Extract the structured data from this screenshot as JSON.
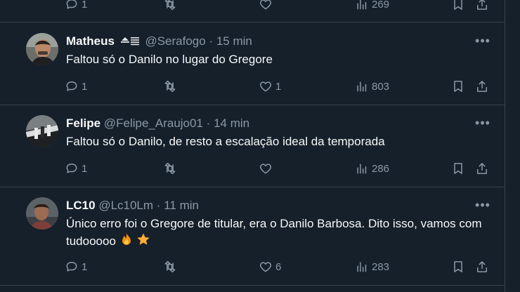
{
  "top_partial": {
    "replies": "1",
    "views": "269"
  },
  "tweets": [
    {
      "name": "Matheus",
      "handle": "@Serafogo",
      "dot": "·",
      "time": "15 min",
      "text": "Faltou só o Danilo no lugar do Gregore",
      "replies": "1",
      "likes": "1",
      "views": "803",
      "avatar": "avatar-photo"
    },
    {
      "name": "Felipe",
      "handle": "@Felipe_Araujo01",
      "dot": "·",
      "time": "14 min",
      "text": "Faltou só o Danilo, de resto a escalação ideal da temporada",
      "replies": "1",
      "likes": "",
      "views": "286",
      "avatar": "avatar-photo"
    },
    {
      "name": "LC10",
      "handle": "@Lc10Lm",
      "dot": "·",
      "time": "11 min",
      "text": "Único erro foi o Gregore de titular, era o Danilo Barbosa. Dito isso, vamos com tudooooo",
      "replies": "1",
      "likes": "6",
      "views": "283",
      "avatar": "avatar-photo",
      "emojis": [
        "fire-emoji",
        "star-emoji"
      ]
    }
  ],
  "icons": {
    "reply": "reply-icon",
    "retweet": "retweet-icon",
    "like": "heart-icon",
    "views": "views-icon",
    "bookmark": "bookmark-icon",
    "share": "share-icon",
    "more": "more-icon"
  },
  "colors": {
    "background": "#15202b",
    "border": "#38444d",
    "muted": "#8b98a5",
    "text": "#f7f9f9"
  }
}
